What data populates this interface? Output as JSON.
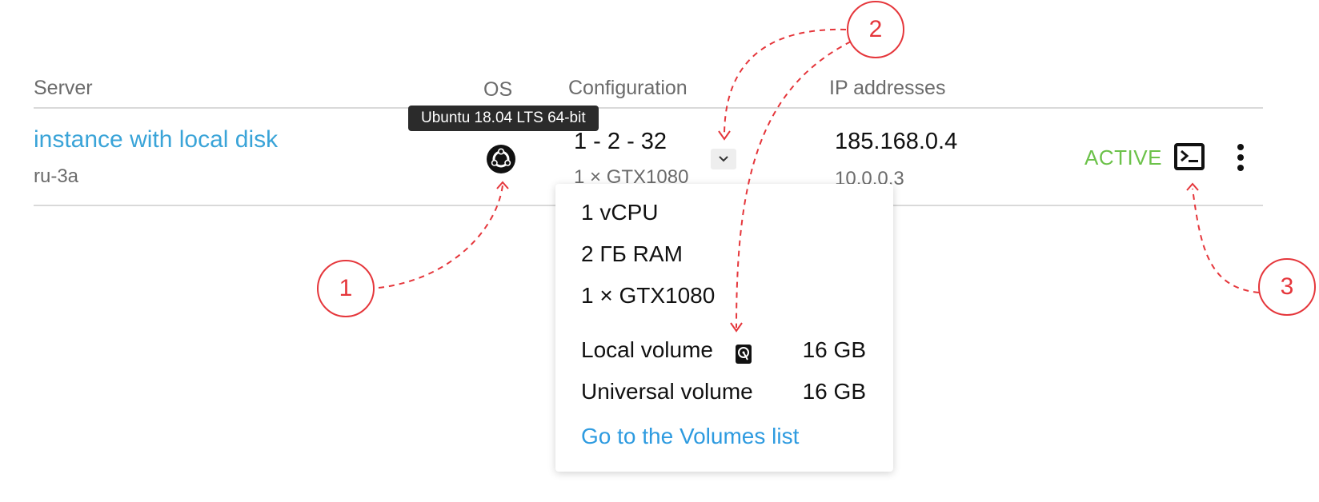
{
  "header": {
    "server": "Server",
    "os": "OS",
    "configuration": "Configuration",
    "ip_addresses": "IP addresses"
  },
  "row": {
    "name": "instance with local disk",
    "region": "ru-3a",
    "os_tooltip": "Ubuntu 18.04 LTS 64-bit",
    "os_icon": "ubuntu-logo-icon",
    "config_main": "1 - 2 - 32",
    "config_sub": "1 × GTX1080",
    "ip_primary": "185.168.0.4",
    "ip_secondary": "10.0.0.3",
    "status": "ACTIVE",
    "console_icon": "terminal-icon",
    "more_icon": "more-vertical-icon"
  },
  "dropdown": {
    "vcpu": "1 vCPU",
    "ram": "2 ГБ RAM",
    "gpu": "1 × GTX1080",
    "local_volume_label": "Local volume",
    "local_volume_value": "16 GB",
    "universal_volume_label": "Universal volume",
    "universal_volume_value": "16 GB",
    "link": "Go to the Volumes list",
    "disk_icon": "hard-disk-icon"
  },
  "callouts": {
    "one": "1",
    "two": "2",
    "three": "3"
  },
  "colors": {
    "link": "#3aa4d8",
    "status_active": "#6cc24a",
    "annotation": "#e5363b",
    "tooltip_bg": "#2b2b2b"
  }
}
